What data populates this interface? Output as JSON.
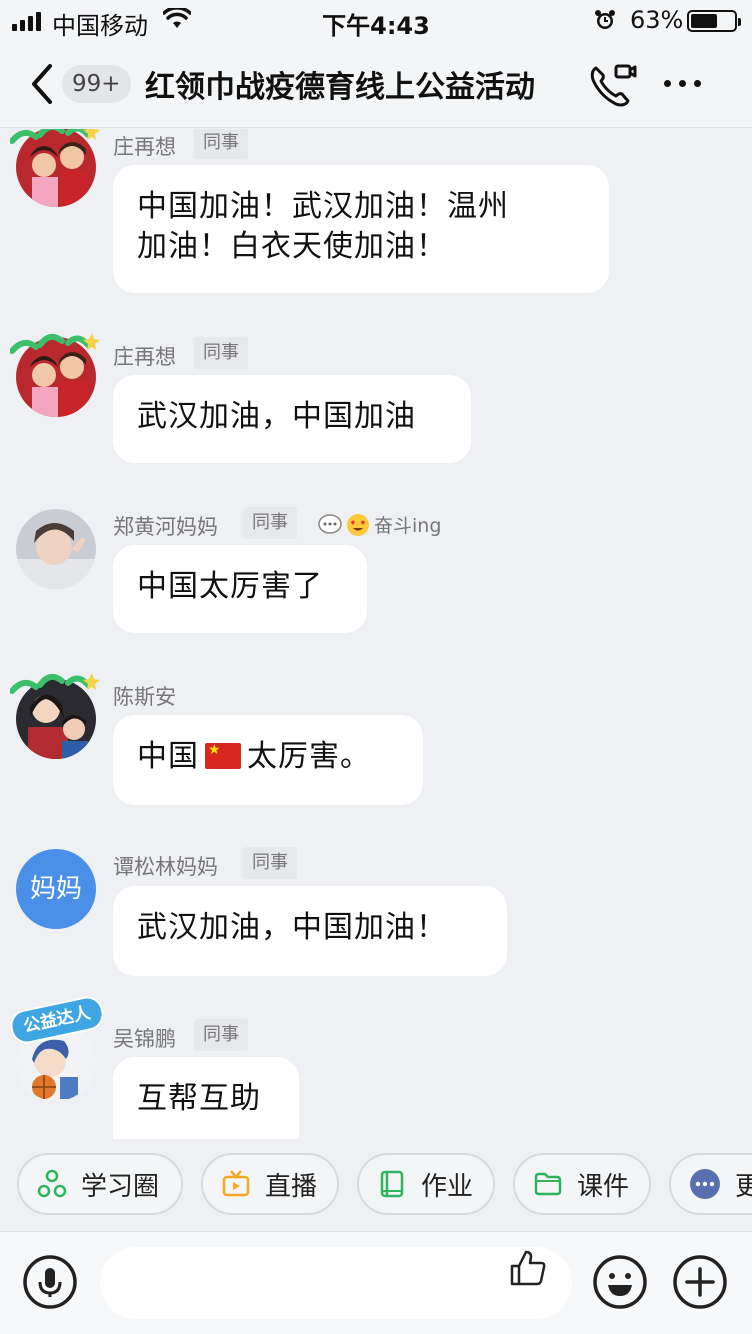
{
  "status_bar": {
    "carrier": "中国移动",
    "time": "下午4:43",
    "battery_pct": "63%",
    "battery_level": 0.63
  },
  "header": {
    "unread_badge": "99+",
    "title": "红领巾战疫德育线上公益活动"
  },
  "messages": [
    {
      "name": "庄再想",
      "tag": "同事",
      "text": "中国加油！武汉加油！温州加油！白衣天使加油！",
      "lines": [
        "中国加油！武汉加油！温州",
        "加油！白衣天使加油！"
      ]
    },
    {
      "name": "庄再想",
      "tag": "同事",
      "text": "武汉加油，中国加油"
    },
    {
      "name": "郑黄河妈妈",
      "tag": "同事",
      "status": "奋斗ing",
      "text": "中国太厉害了"
    },
    {
      "name": "陈斯安",
      "text_before": "中国",
      "text_after": "太厉害。"
    },
    {
      "name": "谭松林妈妈",
      "tag": "同事",
      "avatar_text": "妈妈",
      "text": "武汉加油，中国加油！"
    },
    {
      "name": "吴锦鹏",
      "tag": "同事",
      "avatar_badge": "公益达人",
      "text": "互帮互助"
    }
  ],
  "quick_actions": [
    {
      "label": "学习圈",
      "icon": "circle-cluster-icon"
    },
    {
      "label": "直播",
      "icon": "tv-icon"
    },
    {
      "label": "作业",
      "icon": "book-icon"
    },
    {
      "label": "课件",
      "icon": "folder-icon"
    },
    {
      "label": "更",
      "icon": "more-dots-icon"
    }
  ],
  "input": {
    "placeholder": ""
  },
  "colors": {
    "background": "#eef0f3",
    "bubble": "#ffffff",
    "accent_blue": "#4a8fe8",
    "green": "#2fb45c",
    "orange": "#f5a623"
  }
}
